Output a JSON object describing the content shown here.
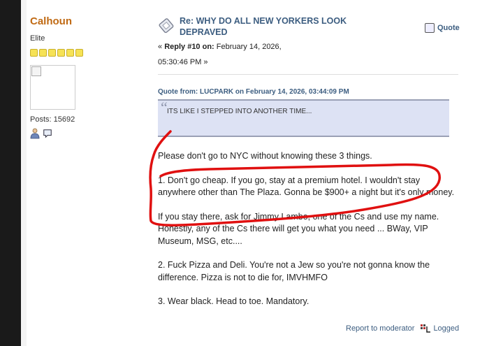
{
  "poster": {
    "name": "Calhoun",
    "rank": "Elite",
    "star_count": 6,
    "posts_label": "Posts: 15692"
  },
  "post": {
    "subject": "Re: WHY DO ALL NEW YORKERS LOOK DEPRAVED",
    "quote_label": "Quote",
    "reply_prefix": "« ",
    "reply_number": "Reply #10 on:",
    "reply_date": " February 14, 2026, 05:30:46 PM »"
  },
  "quote": {
    "header": "Quote from: LUCPARK on February 14, 2026, 03:44:09 PM",
    "text": "ITS LIKE I STEPPED INTO ANOTHER TIME..."
  },
  "body": {
    "p1": "Please don't go to NYC without knowing these 3 things.",
    "p2": "1. Don't go cheap. If you go, stay at a premium hotel.  I wouldn't stay anywhere other than The Plaza. Gonna be $900+ a night but it's only money.",
    "p3": "If you stay there, ask for Jimmy Lambo, one of the Cs and use my name. Honestly, any of the Cs there will get you what you need ... BWay, VIP Museum, MSG, etc....",
    "p4": "2. Fuck Pizza and Deli. You're not a Jew so you're not gonna know the difference.  Pizza is not to die for, IMVHMFO",
    "p5": "3. Wear black.  Head to toe.  Mandatory."
  },
  "footer": {
    "report_label": "Report to moderator",
    "logged_label": "Logged"
  },
  "colors": {
    "poster_name": "#c06a14",
    "link_blue": "#3c5d80",
    "quote_bg": "#dde2f4",
    "annotation_red": "#e01010"
  }
}
